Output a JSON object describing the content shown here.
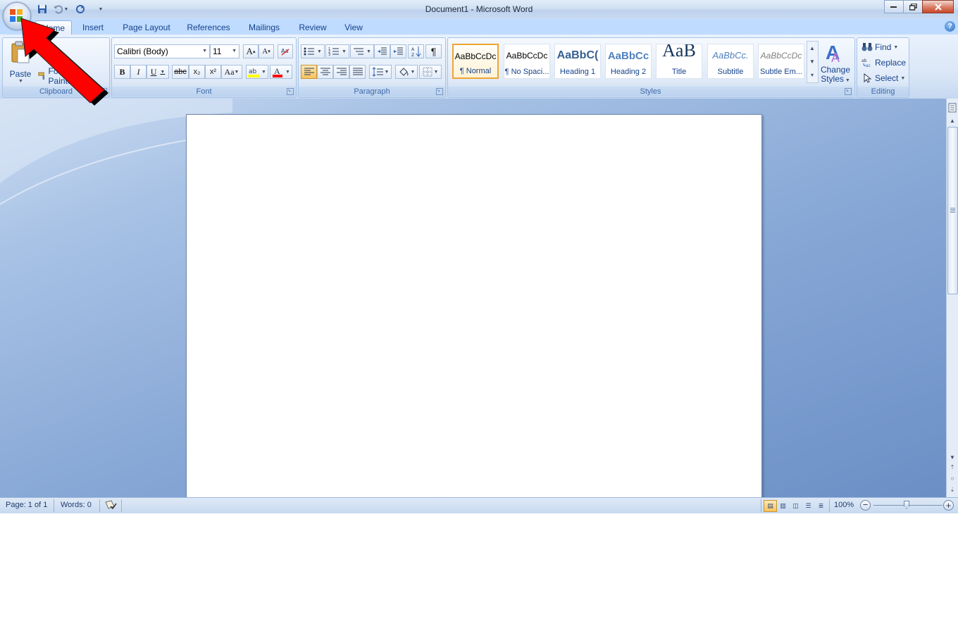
{
  "window": {
    "title": "Document1 - Microsoft Word"
  },
  "tabs": [
    "Home",
    "Insert",
    "Page Layout",
    "References",
    "Mailings",
    "Review",
    "View"
  ],
  "clipboard": {
    "paste_label": "Paste",
    "format_painter_label": "Format Painter",
    "group_label": "Clipboard"
  },
  "font": {
    "family": "Calibri (Body)",
    "size": "11",
    "group_label": "Font",
    "bold": "B",
    "italic": "I",
    "underline": "U",
    "strike": "abc",
    "subscript": "x₂",
    "superscript": "x²",
    "change_case": "Aa",
    "highlight_color": "#ffff00",
    "font_color": "#ff0000"
  },
  "paragraph": {
    "group_label": "Paragraph"
  },
  "styles": {
    "group_label": "Styles",
    "items": [
      {
        "sample": "AaBbCcDc",
        "name": "¶ Normal"
      },
      {
        "sample": "AaBbCcDc",
        "name": "¶ No Spaci..."
      },
      {
        "sample": "AaBbC(",
        "name": "Heading 1"
      },
      {
        "sample": "AaBbCc",
        "name": "Heading 2"
      },
      {
        "sample": "AaB",
        "name": "Title"
      },
      {
        "sample": "AaBbCc.",
        "name": "Subtitle"
      },
      {
        "sample": "AaBbCcDc",
        "name": "Subtle Em..."
      }
    ],
    "change_styles_line1": "Change",
    "change_styles_line2": "Styles"
  },
  "editing": {
    "group_label": "Editing",
    "find": "Find",
    "replace": "Replace",
    "select": "Select"
  },
  "status": {
    "page": "Page: 1 of 1",
    "words": "Words: 0",
    "zoom": "100%"
  },
  "colors": {
    "annotation_arrow": "#ff0000",
    "accent": "#15428b"
  }
}
